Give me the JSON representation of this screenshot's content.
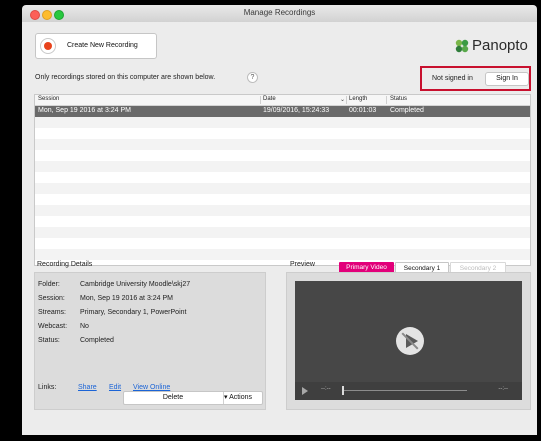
{
  "window": {
    "title": "Manage Recordings"
  },
  "toolbar": {
    "new_recording_label": "Create New Recording"
  },
  "logo": {
    "text": "Panopto"
  },
  "notice": {
    "text": "Only recordings stored on this computer are shown below.",
    "help": "?"
  },
  "auth": {
    "status": "Not signed in",
    "sign_in_label": "Sign In"
  },
  "table": {
    "columns": [
      "Session",
      "Date",
      "Length",
      "Status"
    ],
    "sort_indicator": "⌄",
    "rows": [
      {
        "session": "Mon, Sep 19 2016 at 3:24 PM",
        "date": "19/09/2016, 15:24:33",
        "length": "00:01:03",
        "status": "Completed"
      }
    ]
  },
  "details": {
    "heading": "Recording Details",
    "fields": [
      {
        "label": "Folder:",
        "value": "Cambridge University Moodle\\skj27"
      },
      {
        "label": "Session:",
        "value": "Mon, Sep 19 2016 at 3:24 PM"
      },
      {
        "label": "Streams:",
        "value": "Primary, Secondary 1, PowerPoint"
      },
      {
        "label": "Webcast:",
        "value": "No"
      },
      {
        "label": "Status:",
        "value": "Completed"
      }
    ],
    "links_label": "Links:",
    "links": [
      "Share",
      "Edit",
      "View Online"
    ],
    "delete_label": "Delete",
    "actions_label": "▾ Actions"
  },
  "preview": {
    "heading": "Preview",
    "tabs": [
      "Primary Video",
      "Secondary 1",
      "Secondary 2"
    ],
    "time_left": "--:--",
    "time_right": "--:--"
  },
  "colors": {
    "accent": "#e2007a",
    "record": "#e8431c",
    "highlight_box": "#c8102e",
    "link": "#1b64d6"
  }
}
